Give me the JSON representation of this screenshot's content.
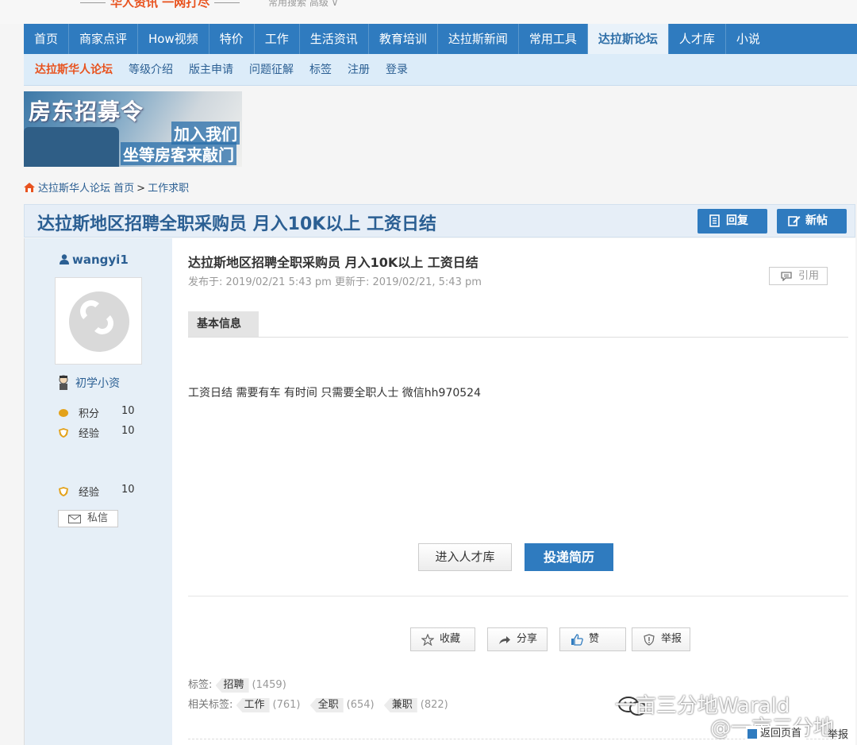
{
  "top": {
    "slogan": "华人资讯 一网打尽",
    "faint": "常用搜索 高级 ∨"
  },
  "nav": {
    "items": [
      "首页",
      "商家点评",
      "How视频",
      "特价",
      "工作",
      "生活资讯",
      "教育培训",
      "达拉斯新闻",
      "常用工具",
      "达拉斯论坛",
      "人才库",
      "小说"
    ],
    "active_index": 9
  },
  "subnav": {
    "items": [
      "达拉斯华人论坛",
      "等级介绍",
      "版主申请",
      "问题征解",
      "标签",
      "注册",
      "登录"
    ]
  },
  "banner": {
    "line1": "房东招募令",
    "line2": "加入我们",
    "line3": "坐等房客来敲门"
  },
  "breadcrumb": {
    "forum": "达拉斯华人论坛",
    "home": "首页",
    "sep": ">",
    "section": "工作求职"
  },
  "thread": {
    "title": "达拉斯地区招聘全职采购员 月入10K以上 工资日结",
    "reply_label": "回复",
    "new_label": "新帖"
  },
  "user": {
    "name": "wangyi1",
    "rank": "初学小资",
    "stats": [
      {
        "label": "积分",
        "value": "10"
      },
      {
        "label": "经验",
        "value": "10"
      },
      {
        "label": "经验",
        "value": "10"
      }
    ],
    "pm_label": "私信"
  },
  "post": {
    "title": "达拉斯地区招聘全职采购员 月入10K以上 工资日结",
    "meta": "发布于: 2019/02/21  5:43 pm 更新于: 2019/02/21, 5:43 pm",
    "quote_label": "引用",
    "tab_label": "基本信息",
    "body": "工资日结 需要有车 有时间 只需要全职人士 微信hh970524",
    "talent_btn": "进入人才库",
    "apply_btn": "投递简历",
    "actions": [
      "收藏",
      "分享",
      "赞",
      "举报"
    ],
    "tags_label": "标签:",
    "tags": [
      {
        "name": "招聘",
        "count": "(1459)"
      }
    ],
    "related_label": "相关标签:",
    "related": [
      {
        "name": "工作",
        "count": "(761)"
      },
      {
        "name": "全职",
        "count": "(654)"
      },
      {
        "name": "兼职",
        "count": "(822)"
      }
    ]
  },
  "overlay": {
    "watermark1": "一亩三分地Warald",
    "watermark2": "@一亩三分地",
    "back_top": "返回页首",
    "report": "举报"
  },
  "colors": {
    "nav_bg": "#2f7bbf",
    "accent_orange": "#e8531f",
    "link_blue": "#2b5f93"
  }
}
